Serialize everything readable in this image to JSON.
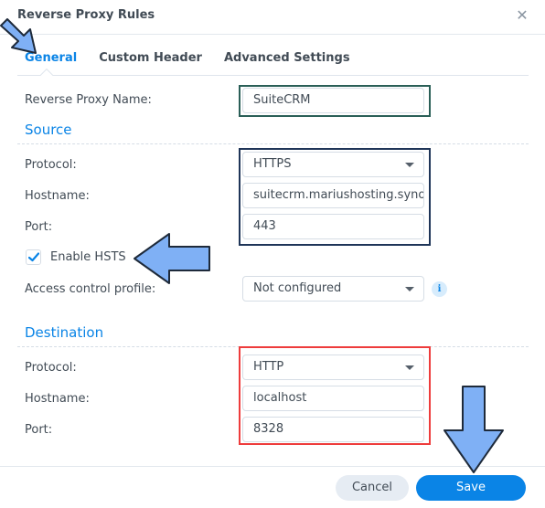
{
  "dialog": {
    "title": "Reverse Proxy Rules",
    "close_icon": "close-icon"
  },
  "tabs": [
    {
      "label": "General",
      "active": true
    },
    {
      "label": "Custom Header",
      "active": false
    },
    {
      "label": "Advanced Settings",
      "active": false
    }
  ],
  "general": {
    "name_label": "Reverse Proxy Name:",
    "name_value": "SuiteCRM"
  },
  "source": {
    "title": "Source",
    "protocol_label": "Protocol:",
    "protocol_value": "HTTPS",
    "hostname_label": "Hostname:",
    "hostname_value": "suitecrm.mariushosting.synology.me",
    "port_label": "Port:",
    "port_value": "443",
    "hsts_label": "Enable HSTS",
    "hsts_checked": true,
    "access_label": "Access control profile:",
    "access_value": "Not configured",
    "info_icon": "info-icon"
  },
  "destination": {
    "title": "Destination",
    "protocol_label": "Protocol:",
    "protocol_value": "HTTP",
    "hostname_label": "Hostname:",
    "hostname_value": "localhost",
    "port_label": "Port:",
    "port_value": "8328"
  },
  "footer": {
    "cancel_label": "Cancel",
    "save_label": "Save"
  },
  "annotations": {
    "arrow_color": "#7fb0f5",
    "highlight_name_color": "#2a5f57",
    "highlight_source_color": "#1f3558",
    "highlight_destination_color": "#ee3c3c"
  },
  "colors": {
    "accent": "#0a84e6",
    "text": "#414b55"
  }
}
